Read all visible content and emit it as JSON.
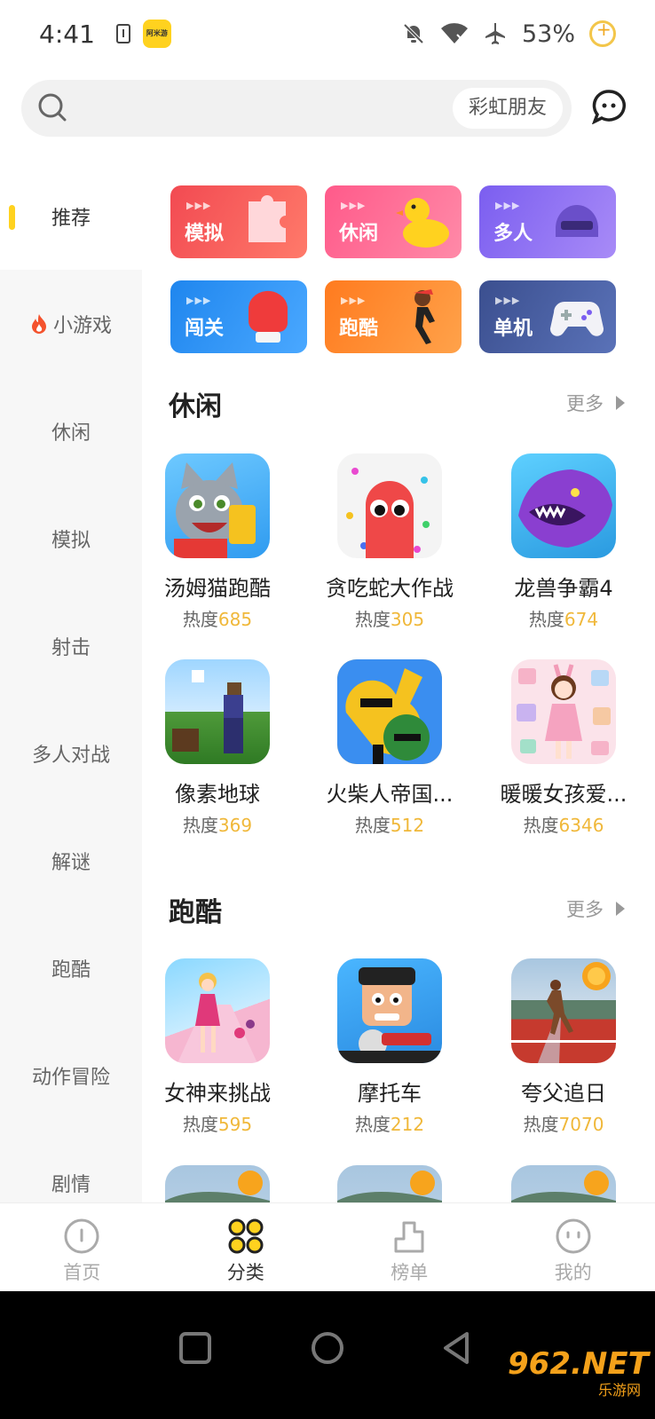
{
  "status_bar": {
    "time": "4:41",
    "app_badge": "阿米游",
    "battery": "53%"
  },
  "search": {
    "suggestion": "彩虹朋友"
  },
  "sidebar": {
    "items": [
      {
        "label": "推荐"
      },
      {
        "label": "小游戏",
        "icon": "fire-icon"
      },
      {
        "label": "休闲"
      },
      {
        "label": "模拟"
      },
      {
        "label": "射击"
      },
      {
        "label": "多人对战"
      },
      {
        "label": "解谜"
      },
      {
        "label": "跑酷"
      },
      {
        "label": "动作冒险"
      },
      {
        "label": "剧情"
      }
    ]
  },
  "categories": [
    {
      "label": "模拟",
      "color": "#f5565a",
      "icon": "puzzle-icon"
    },
    {
      "label": "休闲",
      "color": "#ff6a8e",
      "icon": "duck-icon"
    },
    {
      "label": "多人",
      "color": "#8a6ff2",
      "icon": "helmet-icon"
    },
    {
      "label": "闯关",
      "color": "#2b8ff0",
      "icon": "boxing-glove-icon"
    },
    {
      "label": "跑酷",
      "color": "#ff8a2a",
      "icon": "runner-icon"
    },
    {
      "label": "单机",
      "color": "#4a5f9e",
      "icon": "gamepad-icon"
    }
  ],
  "sections": [
    {
      "title": "休闲",
      "more": "更多",
      "games": [
        {
          "name": "汤姆猫跑酷",
          "heat_label": "热度",
          "heat": "685"
        },
        {
          "name": "贪吃蛇大作战",
          "heat_label": "热度",
          "heat": "305"
        },
        {
          "name": "龙兽争霸4",
          "heat_label": "热度",
          "heat": "674"
        },
        {
          "name": "像素地球",
          "heat_label": "热度",
          "heat": "369"
        },
        {
          "name": "火柴人帝国...",
          "heat_label": "热度",
          "heat": "512"
        },
        {
          "name": "暖暖女孩爱...",
          "heat_label": "热度",
          "heat": "6346"
        }
      ]
    },
    {
      "title": "跑酷",
      "more": "更多",
      "games": [
        {
          "name": "女神来挑战",
          "heat_label": "热度",
          "heat": "595"
        },
        {
          "name": "摩托车",
          "heat_label": "热度",
          "heat": "212"
        },
        {
          "name": "夸父追日",
          "heat_label": "热度",
          "heat": "7070"
        }
      ]
    }
  ],
  "bottom_nav": [
    {
      "label": "首页"
    },
    {
      "label": "分类"
    },
    {
      "label": "榜单"
    },
    {
      "label": "我的"
    }
  ],
  "watermark": {
    "main": "962.NET",
    "sub": "乐游网"
  },
  "colors": {
    "accent": "#ffd21f",
    "heat": "#f0b83a"
  }
}
